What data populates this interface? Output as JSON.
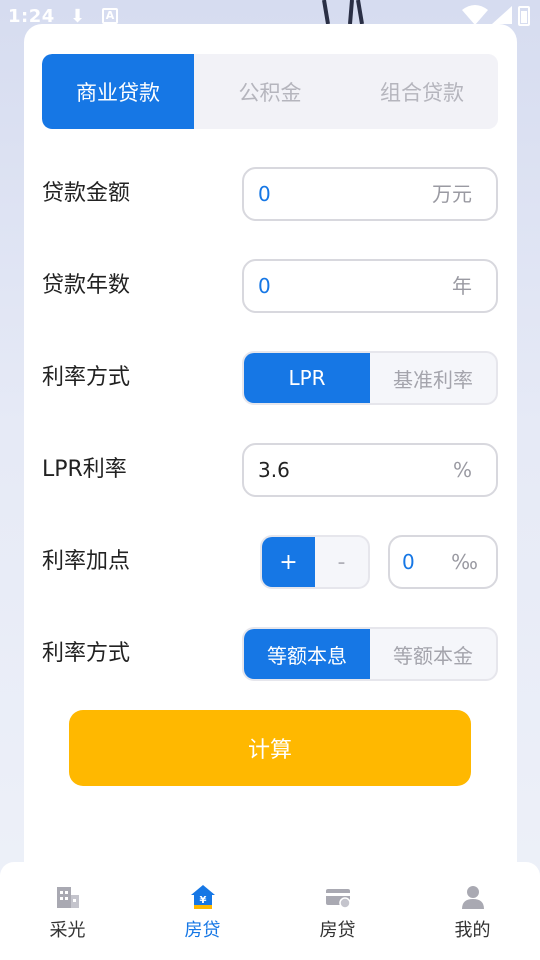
{
  "status_bar": {
    "time": "1:24"
  },
  "tabs": [
    {
      "label": "商业贷款",
      "active": true
    },
    {
      "label": "公积金",
      "active": false
    },
    {
      "label": "组合贷款",
      "active": false
    }
  ],
  "loan_amount": {
    "label": "贷款金额",
    "value": "0",
    "unit": "万元"
  },
  "loan_years": {
    "label": "贷款年数",
    "value": "0",
    "unit": "年"
  },
  "rate_mode": {
    "label": "利率方式",
    "options": [
      "LPR",
      "基准利率"
    ],
    "selected": "LPR"
  },
  "lpr_rate": {
    "label": "LPR利率",
    "value": "3.6",
    "unit": "%"
  },
  "rate_points": {
    "label": "利率加点",
    "plus": "+",
    "minus": "-",
    "value": "0",
    "unit": "‰"
  },
  "repay_mode": {
    "label": "利率方式",
    "options": [
      "等额本息",
      "等额本金"
    ],
    "selected": "等额本息"
  },
  "calculate_button": {
    "label": "计算"
  },
  "bottom_nav": [
    {
      "label": "采光",
      "icon": "building-icon",
      "active": false
    },
    {
      "label": "房贷",
      "icon": "house-yuan-icon",
      "active": true
    },
    {
      "label": "房贷",
      "icon": "card-icon",
      "active": false
    },
    {
      "label": "我的",
      "icon": "user-icon",
      "active": false
    }
  ],
  "colors": {
    "accent": "#1677e5",
    "button": "#ffb800",
    "muted": "#a4a4ac"
  }
}
